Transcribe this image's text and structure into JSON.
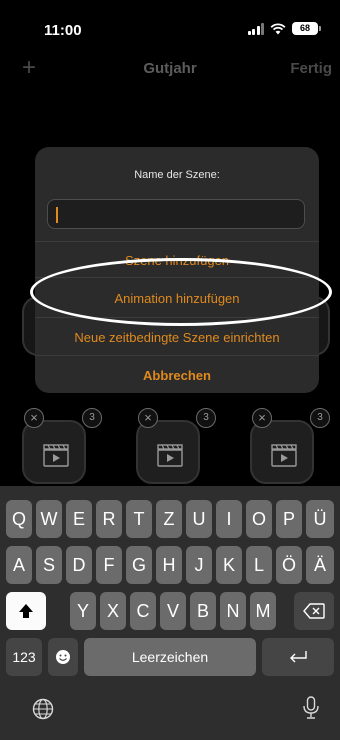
{
  "status_bar": {
    "time": "11:00",
    "battery": "68"
  },
  "nav": {
    "add_icon": "plus-icon",
    "title": "Gutjahr",
    "done_label": "Fertig"
  },
  "tiles": [
    {
      "badge_close": "×",
      "badge_count": "3",
      "icon": "clapperboard-icon"
    },
    {
      "badge_close": "×",
      "badge_count": "3",
      "icon": "clapperboard-icon"
    },
    {
      "badge_close": "×",
      "badge_count": "3",
      "icon": "clapperboard-icon"
    }
  ],
  "dialog": {
    "title": "Name der Szene:",
    "input_value": "",
    "buttons": {
      "add_scene": "Szene hinzufügen",
      "add_animation": "Animation hinzufügen",
      "timed_scene": "Neue zeitbedingte Szene einrichten",
      "cancel": "Abbrechen"
    }
  },
  "keyboard": {
    "row1": [
      "Q",
      "W",
      "E",
      "R",
      "T",
      "Z",
      "U",
      "I",
      "O",
      "P",
      "Ü"
    ],
    "row2": [
      "A",
      "S",
      "D",
      "F",
      "G",
      "H",
      "J",
      "K",
      "L",
      "Ö",
      "Ä"
    ],
    "row3": [
      "Y",
      "X",
      "C",
      "V",
      "B",
      "N",
      "M"
    ],
    "numbers_key": "123",
    "space_key": "Leerzeichen",
    "shift_icon": "shift-icon",
    "backspace_icon": "backspace-icon",
    "emoji_icon": "emoji-icon",
    "return_icon": "return-icon",
    "globe_icon": "globe-icon",
    "mic_icon": "microphone-icon"
  },
  "colors": {
    "accent": "#e08a1e",
    "dialog_bg": "#2b2b2b",
    "key_bg": "#6b6b6b",
    "keyboard_bg": "#2e2e2e"
  }
}
